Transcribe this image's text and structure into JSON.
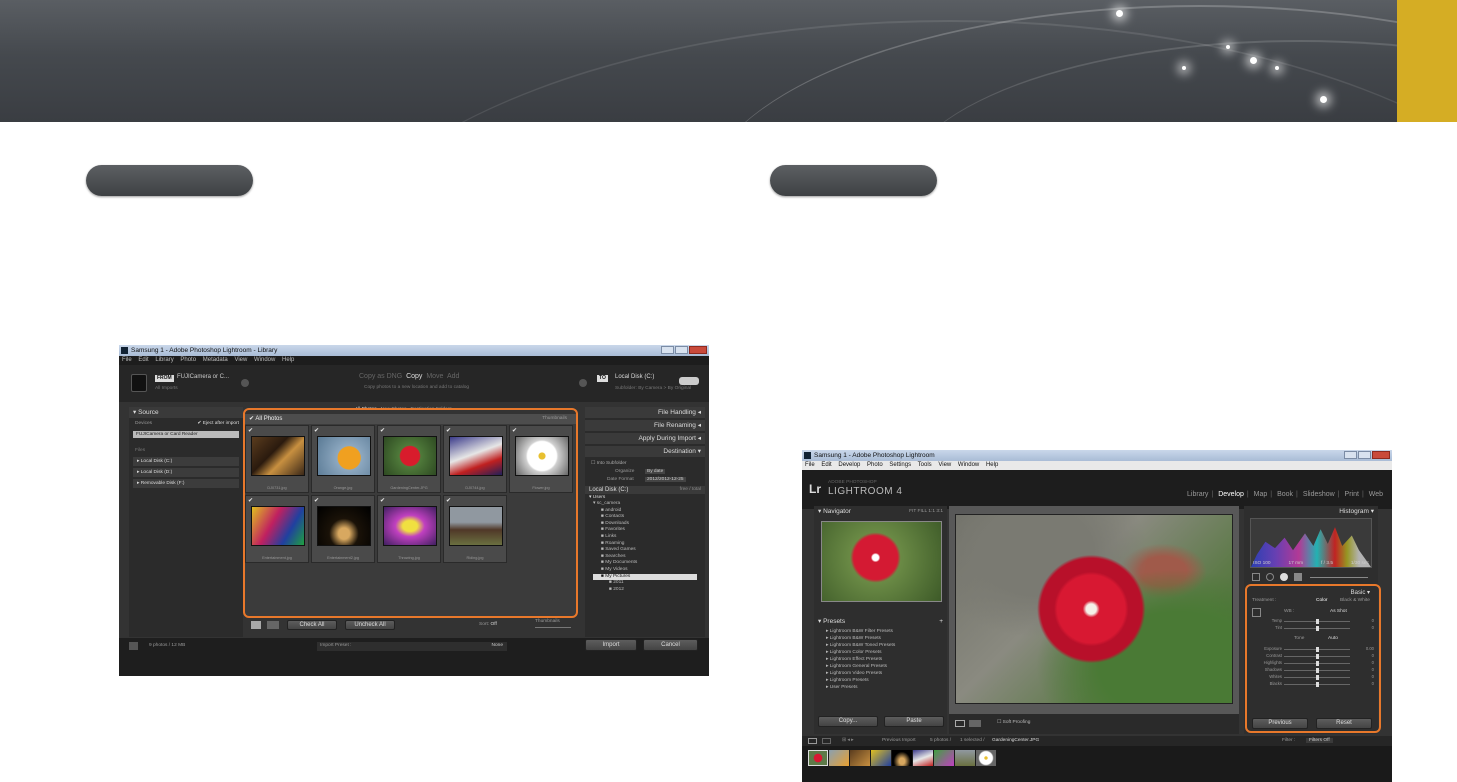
{
  "left_screenshot": {
    "window_title": "Samsung 1 - Adobe Photoshop Lightroom - Library",
    "menu": [
      "File",
      "Edit",
      "Library",
      "Photo",
      "Metadata",
      "View",
      "Window",
      "Help"
    ],
    "from_label": "FROM",
    "from_source": "FUJICamera or C...",
    "from_sub": "All Imports",
    "modes": [
      "Copy as DNG",
      "Copy",
      "Move",
      "Add"
    ],
    "mode_hint": "Copy photos to a new location and add to catalog",
    "to_label": "TO",
    "to_dest": "Local Disk (C:)",
    "to_sub": "Subfolder: By Camera > By Original",
    "source_header": "Source",
    "device_label": "Devices",
    "eject_label": "Eject after import",
    "device_value": "FUJICamera or Card Reader",
    "files_label": "Files",
    "disks": [
      "Local Disk (C:)",
      "Local Disk (D:)",
      "Removable Disk (F:)"
    ],
    "view_tabs": [
      "All Photos",
      "New Photos",
      "Destination Folders"
    ],
    "grid_header": "All Photos",
    "sort_label": "Thumbnails",
    "filenames": [
      "DJ0731.jpg",
      "Orange.jpg",
      "GardeningCenter.JPG",
      "DJ0744.jpg",
      "Flower.jpg",
      "Entertainment.jpg",
      "Entertainment2.jpg",
      "Throwing.jpg",
      "Riding.jpg"
    ],
    "right_sections": [
      "File Handling",
      "File Renaming",
      "Apply During Import",
      "Destination"
    ],
    "into_subfolder": "Into Subfolder",
    "organize_label": "Organize",
    "organize_value": "By date",
    "date_format_label": "Date Format",
    "date_format_value": "2012/2012-12-25",
    "dest_disk": "Local Disk (C:)",
    "dest_disk_free": "free / total",
    "tree": [
      "Users",
      "sc_camera",
      "android",
      "Contacts",
      "Downloads",
      "Favorites",
      "Links",
      "Roaming",
      "Saved Games",
      "Searches",
      "My Documents",
      "My Videos",
      "My Pictures",
      "2011",
      "2012"
    ],
    "check_all": "Check All",
    "uncheck_all": "Uncheck All",
    "sort_footer_label": "Sort:",
    "sort_footer_value": "Off",
    "thumbnails_label": "Thumbnails",
    "footer_count": "9 photos / 12 MB",
    "preset_label": "Import Preset :",
    "preset_value": "None",
    "import_button": "Import",
    "cancel_button": "Cancel"
  },
  "right_screenshot": {
    "window_title": "Samsung 1 - Adobe Photoshop Lightroom",
    "menu": [
      "File",
      "Edit",
      "Develop",
      "Photo",
      "Settings",
      "Tools",
      "View",
      "Window",
      "Help"
    ],
    "brand_small": "ADOBE PHOTOSHOP",
    "brand": "LIGHTROOM 4",
    "lr_logo": "Lr",
    "modules": [
      "Library",
      "Develop",
      "Map",
      "Book",
      "Slideshow",
      "Print",
      "Web"
    ],
    "active_module": "Develop",
    "navigator": "Navigator",
    "nav_zoom": [
      "FIT",
      "FILL",
      "1:1",
      "3:1"
    ],
    "presets": "Presets",
    "preset_items": [
      "Lightroom B&W Filter Presets",
      "Lightroom B&W Presets",
      "Lightroom B&W Toned Presets",
      "Lightroom Color Presets",
      "Lightroom Effect Presets",
      "Lightroom General Presets",
      "Lightroom Video Presets",
      "Lightroom Presets",
      "User Presets"
    ],
    "copy_button": "Copy...",
    "paste_button": "Paste",
    "soft_proofing": "Soft Proofing",
    "histogram": "Histogram",
    "hist_info": [
      "ISO 100",
      "17 mm",
      "f / 3.5",
      "1/30 sec"
    ],
    "basic": "Basic",
    "treatment_label": "Treatment :",
    "treatment_color": "Color",
    "treatment_bw": "Black & White",
    "wb_label": "WB :",
    "wb_value": "As Shot",
    "sliders_top": [
      {
        "label": "Temp",
        "value": "0",
        "pos": 0.5
      },
      {
        "label": "Tint",
        "value": "0",
        "pos": 0.5
      }
    ],
    "tone_label": "Tone",
    "auto_label": "Auto",
    "sliders_tone": [
      {
        "label": "Exposure",
        "value": "0.00",
        "pos": 0.5
      },
      {
        "label": "Contrast",
        "value": "0",
        "pos": 0.5
      },
      {
        "label": "Highlights",
        "value": "0",
        "pos": 0.5
      },
      {
        "label": "Shadows",
        "value": "0",
        "pos": 0.5
      },
      {
        "label": "Whites",
        "value": "0",
        "pos": 0.5
      },
      {
        "label": "Blacks",
        "value": "0",
        "pos": 0.5
      }
    ],
    "previous_button": "Previous",
    "reset_button": "Reset",
    "film_source": "Previous Import",
    "film_count": "5 photos /",
    "film_selected": "1 selected /",
    "film_filename": "GardeningCenter.JPG",
    "filter_label": "Filter :",
    "filter_value": "Filters Off"
  }
}
